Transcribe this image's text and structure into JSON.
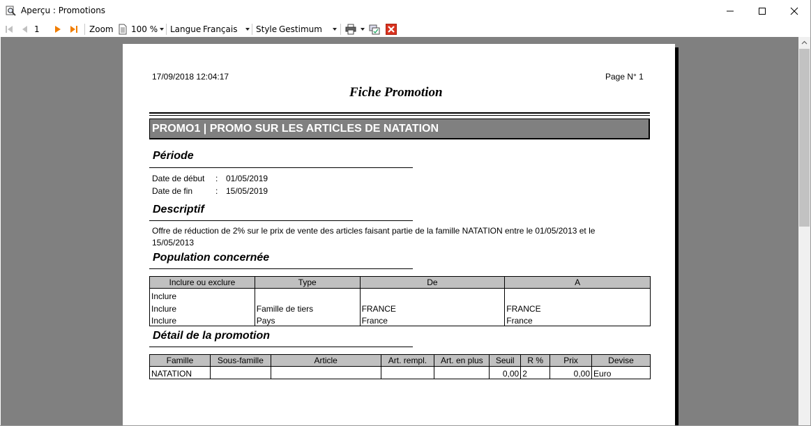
{
  "window": {
    "title": "Aperçu : Promotions",
    "controls": [
      "minimize-icon",
      "maximize-icon",
      "close-icon"
    ]
  },
  "toolbar": {
    "page_number": "1",
    "zoom_label": "Zoom",
    "zoom_value": "100 %",
    "language_label": "Langue",
    "language_value": "Français",
    "style_label": "Style",
    "style_value": "Gestimum",
    "icons": [
      "first-page-icon",
      "prev-page-icon",
      "next-page-icon",
      "last-page-icon",
      "page-icon",
      "print-icon",
      "export-icon",
      "close-preview-icon"
    ],
    "accent_orange": "#f07d00",
    "close_red": "#d9321f"
  },
  "report": {
    "timestamp": "17/09/2018 12:04:17",
    "page_label": "Page N° 1",
    "title": "Fiche Promotion",
    "banner": "PROMO1 | PROMO SUR LES ARTICLES DE NATATION",
    "periode": {
      "heading": "Période",
      "start_label": "Date de début",
      "start_value": "01/05/2019",
      "end_label": "Date de fin",
      "end_value": "15/05/2019",
      "colon": ":"
    },
    "descriptif": {
      "heading": "Descriptif",
      "line1": "Offre de réduction de 2% sur le prix de vente des articles faisant partie de la famille NATATION entre le 01/05/2013 et le",
      "line2": "15/05/2013"
    },
    "population": {
      "heading": "Population concernée",
      "columns": [
        "Inclure ou exclure",
        "Type",
        "De",
        "A"
      ],
      "rows": [
        [
          "Inclure",
          "",
          "",
          ""
        ],
        [
          "Inclure",
          "Famille de tiers",
          "FRANCE",
          "FRANCE"
        ],
        [
          "Inclure",
          "Pays",
          "France",
          "France"
        ]
      ]
    },
    "detail": {
      "heading": "Détail de la promotion",
      "columns": [
        "Famille",
        "Sous-famille",
        "Article",
        "Art. rempl.",
        "Art. en plus",
        "Seuil",
        "R %",
        "Prix",
        "Devise"
      ],
      "rows": [
        [
          "NATATION",
          "",
          "",
          "",
          "",
          "0,00",
          "2",
          "0,00",
          "Euro"
        ]
      ]
    }
  }
}
